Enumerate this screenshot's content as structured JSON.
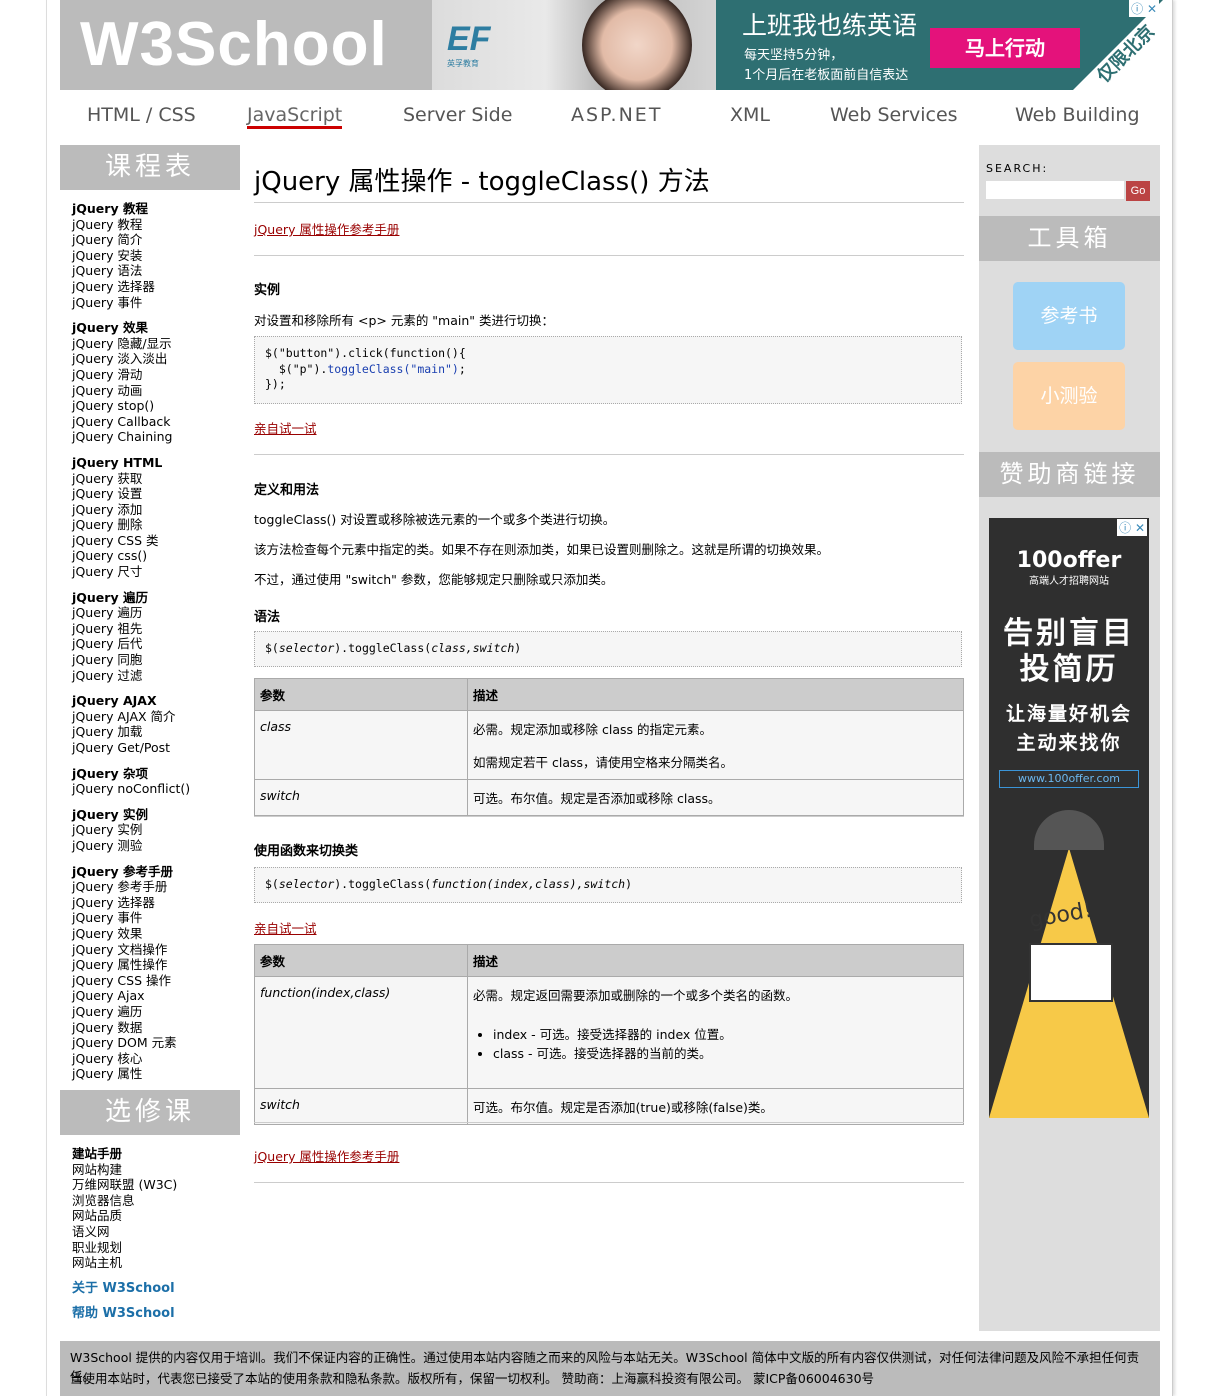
{
  "header": {
    "logo": "W3School",
    "ad": {
      "brand": "EF",
      "brand_sub": "英孚教育",
      "headline": "上班我也练英语",
      "line1": "每天坚持5分钟，",
      "line2": "1个月后在老板面前自信表达",
      "cta": "马上行动",
      "corner": "仅限北京",
      "adchoices": "ⓘ ✕"
    }
  },
  "nav": {
    "items": [
      "HTML / CSS",
      "JavaScript",
      "Server Side",
      "ASP.NET",
      "XML",
      "Web Services",
      "Web Building"
    ],
    "active": "JavaScript"
  },
  "left": {
    "heading1": "课程表",
    "groups": [
      {
        "title": "jQuery 教程",
        "items": [
          "jQuery 教程",
          "jQuery 简介",
          "jQuery 安装",
          "jQuery 语法",
          "jQuery 选择器",
          "jQuery 事件"
        ]
      },
      {
        "title": "jQuery 效果",
        "items": [
          "jQuery 隐藏/显示",
          "jQuery 淡入淡出",
          "jQuery 滑动",
          "jQuery 动画",
          "jQuery stop()",
          "jQuery Callback",
          "jQuery Chaining"
        ]
      },
      {
        "title": "jQuery HTML",
        "items": [
          "jQuery 获取",
          "jQuery 设置",
          "jQuery 添加",
          "jQuery 删除",
          "jQuery CSS 类",
          "jQuery css()",
          "jQuery 尺寸"
        ]
      },
      {
        "title": "jQuery 遍历",
        "items": [
          "jQuery 遍历",
          "jQuery 祖先",
          "jQuery 后代",
          "jQuery 同胞",
          "jQuery 过滤"
        ]
      },
      {
        "title": "jQuery AJAX",
        "items": [
          "jQuery AJAX 简介",
          "jQuery 加载",
          "jQuery Get/Post"
        ]
      },
      {
        "title": "jQuery 杂项",
        "items": [
          "jQuery noConflict()"
        ]
      },
      {
        "title": "jQuery 实例",
        "items": [
          "jQuery 实例",
          "jQuery 测验"
        ]
      },
      {
        "title": "jQuery 参考手册",
        "items": [
          "jQuery 参考手册",
          "jQuery 选择器",
          "jQuery 事件",
          "jQuery 效果",
          "jQuery 文档操作",
          "jQuery 属性操作",
          "jQuery CSS 操作",
          "jQuery Ajax",
          "jQuery 遍历",
          "jQuery 数据",
          "jQuery DOM 元素",
          "jQuery 核心",
          "jQuery 属性"
        ]
      }
    ],
    "heading2": "选修课",
    "elective_title": "建站手册",
    "elective_items": [
      "网站构建",
      "万维网联盟 (W3C)",
      "浏览器信息",
      "网站品质",
      "语义网",
      "职业规划",
      "网站主机"
    ],
    "about": "关于 W3School",
    "help": "帮助 W3School"
  },
  "main": {
    "title": "jQuery 属性操作 - toggleClass() 方法",
    "ref_link": "jQuery 属性操作参考手册",
    "example_heading": "实例",
    "example_desc": "对设置和移除所有 <p> 元素的 \"main\" 类进行切换：",
    "code1": {
      "line1": "$(\"button\").click(function(){",
      "line2_pre": "  $(\"p\").",
      "line2_fn": "toggleClass(\"main\")",
      "line2_post": ";",
      "line3": "});"
    },
    "try_link": "亲自试一试",
    "def_heading": "定义和用法",
    "def_p1": "toggleClass() 对设置或移除被选元素的一个或多个类进行切换。",
    "def_p2": "该方法检查每个元素中指定的类。如果不存在则添加类，如果已设置则删除之。这就是所谓的切换效果。",
    "def_p3": "不过，通过使用 \"switch\" 参数，您能够规定只删除或只添加类。",
    "syntax_heading": "语法",
    "syntax_code_pre": "$(",
    "syntax_code_sel": "selector",
    "syntax_code_mid": ").toggleClass(",
    "syntax_code_args": "class,switch",
    "syntax_code_post": ")",
    "table1": {
      "headers": [
        "参数",
        "描述"
      ],
      "rows": [
        {
          "param": "class",
          "desc1": "必需。规定添加或移除 class 的指定元素。",
          "desc2": "如需规定若干 class，请使用空格来分隔类名。"
        },
        {
          "param": "switch",
          "desc1": "可选。布尔值。规定是否添加或移除 class。"
        }
      ]
    },
    "func_heading": "使用函数来切换类",
    "func_code_pre": "$(",
    "func_code_sel": "selector",
    "func_code_mid": ").toggleClass(",
    "func_code_args": "function(index,class),switch",
    "func_code_post": ")",
    "try_link2": "亲自试一试",
    "table2": {
      "headers": [
        "参数",
        "描述"
      ],
      "row1_param": "function(index,class)",
      "row1_desc": "必需。规定返回需要添加或删除的一个或多个类名的函数。",
      "row1_bullets": [
        "index - 可选。接受选择器的 index 位置。",
        "class - 可选。接受选择器的当前的类。"
      ],
      "row2_param": "switch",
      "row2_desc": "可选。布尔值。规定是否添加(true)或移除(false)类。"
    },
    "ref_link2": "jQuery 属性操作参考手册"
  },
  "right": {
    "search_label": "SEARCH:",
    "search_placeholder": "",
    "go": "Go",
    "toolbox": "工具箱",
    "btn_ref": "参考书",
    "btn_quiz": "小测验",
    "sponsor": "赞助商链接",
    "ad": {
      "brand": "100offer",
      "brand_sub": "高端人才招聘网站",
      "line1": "告别盲目",
      "line2": "投简历",
      "line3": "让海量好机会",
      "line4": "主动来找你",
      "url": "www.100offer.com",
      "good": "good!",
      "adchoices": "ⓘ ✕"
    },
    "colors": {
      "ref": "#9fd3f5",
      "quiz": "#fdd3a6"
    }
  },
  "footer": {
    "line1": "W3School 提供的内容仅用于培训。我们不保证内容的正确性。通过使用本站内容随之而来的风险与本站无关。W3School 简体中文版的所有内容仅供测试，对任何法律问题及风险不承担任何责任。",
    "line2": "当使用本站时，代表您已接受了本站的使用条款和隐私条款。版权所有，保留一切权利。 赞助商：上海赢科投资有限公司。 蒙ICP备06004630号"
  }
}
